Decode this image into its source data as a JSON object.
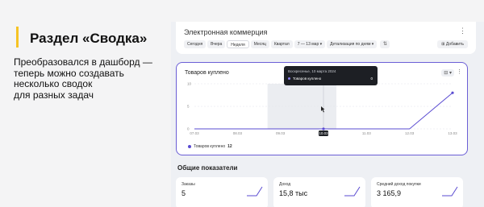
{
  "slide": {
    "title": "Раздел «Сводка»",
    "description_lines": [
      "Преобразовался в дашборд —",
      "теперь можно создавать",
      "несколько сводок",
      "для разных задач"
    ],
    "accent_color": "#f6c324"
  },
  "dashboard": {
    "title": "Электронная коммерция",
    "more_icon": "kebab-icon",
    "periods": [
      {
        "label": "Сегодня",
        "selected": false
      },
      {
        "label": "Вчера",
        "selected": false
      },
      {
        "label": "Неделя",
        "selected": true
      },
      {
        "label": "Месяц",
        "selected": false
      },
      {
        "label": "Квартал",
        "selected": false
      }
    ],
    "date_range": "7 — 13 мар",
    "detail": "Детализация по дням",
    "add_label": "Добавить",
    "accent_color": "#5a4bd1"
  },
  "chart_widget": {
    "title": "Товаров куплено",
    "legend_label": "Товаров куплено",
    "legend_value": "12",
    "tooltip": {
      "date": "Воскресенье, 10 марта 2024",
      "label": "Товаров куплено",
      "value": "0"
    }
  },
  "chart_data": {
    "type": "line",
    "x": [
      "07.03",
      "08.03",
      "09.03",
      "10.03",
      "11.03",
      "12.03",
      "13.03"
    ],
    "y_ticks": [
      "0",
      "5",
      "10"
    ],
    "ylim": [
      0,
      10
    ],
    "series": [
      {
        "name": "Товаров куплено",
        "values": [
          0,
          0,
          0,
          0,
          0,
          0,
          8
        ]
      }
    ],
    "highlight_x": "10.03",
    "color": "#5a4bd1",
    "grid": true
  },
  "summary": {
    "title": "Общие показатели",
    "kpis": [
      {
        "label": "Заказы",
        "value": "5"
      },
      {
        "label": "Доход",
        "value": "15,8 тыс"
      },
      {
        "label": "Средний доход покупки",
        "value": "3 165,9"
      }
    ]
  }
}
